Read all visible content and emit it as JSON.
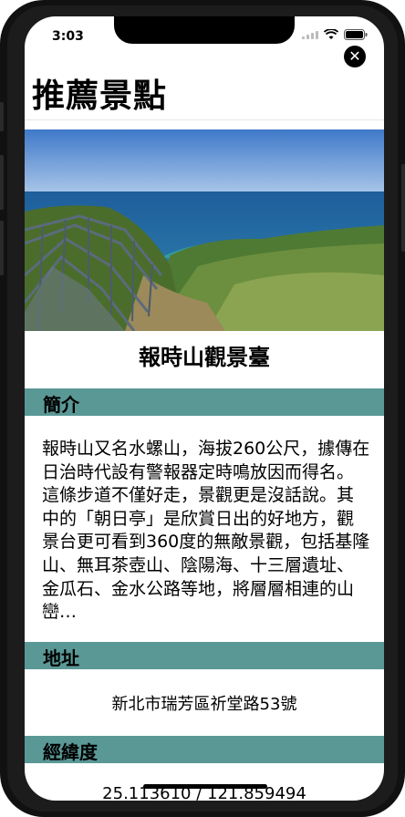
{
  "status_bar": {
    "time": "3:03"
  },
  "close_label": "✕",
  "page_title": "推薦景點",
  "place": {
    "name": "報時山觀景臺",
    "sections": {
      "intro_header": "簡介",
      "intro_text": "報時山又名水螺山，海拔260公尺，據傳在日治時代設有警報器定時鳴放因而得名。這條步道不僅好走，景觀更是沒話說。其中的「朝日亭」是欣賞日出的好地方，觀景台更可看到360度的無敵景觀，包括基隆山、無耳茶壺山、陰陽海、十三層遺址、金瓜石、金水公路等地，將層層相連的山巒…",
      "address_header": "地址",
      "address": "新北市瑞芳區祈堂路53號",
      "coords_header": "經緯度",
      "coords": "25.113610 / 121.859494"
    }
  },
  "colors": {
    "section_header_bg": "#5a9896"
  }
}
